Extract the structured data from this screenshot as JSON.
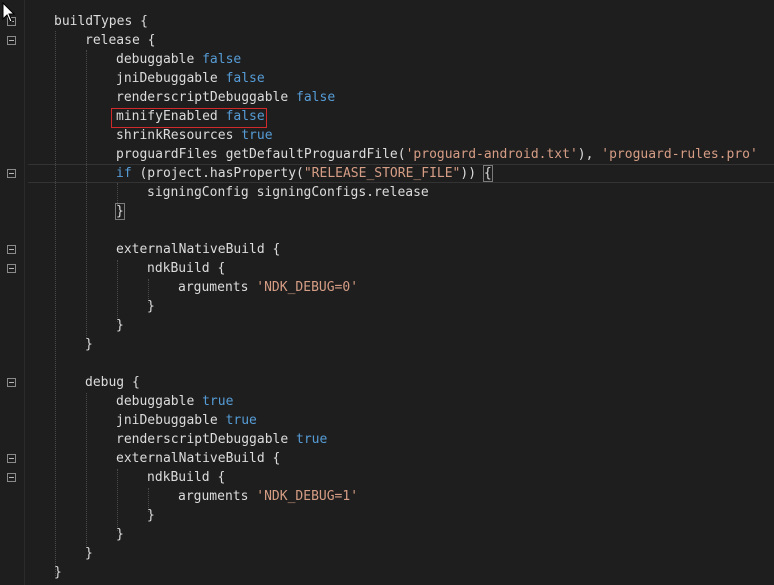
{
  "lines": [
    {
      "t": "buildTypes {"
    },
    {
      "t": "release {"
    },
    {
      "k": "debuggable",
      "v": "false"
    },
    {
      "k": "jniDebuggable",
      "v": "false"
    },
    {
      "k": "renderscriptDebuggable",
      "v": "false"
    },
    {
      "k": "minifyEnabled",
      "v": "false"
    },
    {
      "k": "shrinkResources",
      "v": "true"
    },
    {
      "a": "proguardFiles getDefaultProguardFile(",
      "s1": "'proguard-android.txt'",
      "b": "), ",
      "s2": "'proguard-rules.pro'"
    },
    {
      "kw": "if",
      "a": " (project.hasProperty(",
      "s": "\"RELEASE_STORE_FILE\"",
      "b": ")) ",
      "brace": "{"
    },
    {
      "t": "signingConfig signingConfigs.release"
    },
    {
      "brace": "}"
    },
    {
      "t": "externalNativeBuild {"
    },
    {
      "t": "ndkBuild {"
    },
    {
      "a": "arguments ",
      "s": "'NDK_DEBUG=0'"
    },
    {
      "t": "}"
    },
    {
      "t": "}"
    },
    {
      "t": "}"
    },
    {
      "t": "debug {"
    },
    {
      "k": "debuggable",
      "v": "true"
    },
    {
      "k": "jniDebuggable",
      "v": "true"
    },
    {
      "k": "renderscriptDebuggable",
      "v": "true"
    },
    {
      "t": "externalNativeBuild {"
    },
    {
      "t": "ndkBuild {"
    },
    {
      "a": "arguments ",
      "s": "'NDK_DEBUG=1'"
    },
    {
      "t": "}"
    },
    {
      "t": "}"
    },
    {
      "t": "}"
    },
    {
      "t": "}"
    }
  ],
  "colors": {
    "background": "#1e1e1e",
    "text": "#dcdcdc",
    "keyword": "#569cd6",
    "string": "#d69d85",
    "highlight": "#d12a2a"
  }
}
